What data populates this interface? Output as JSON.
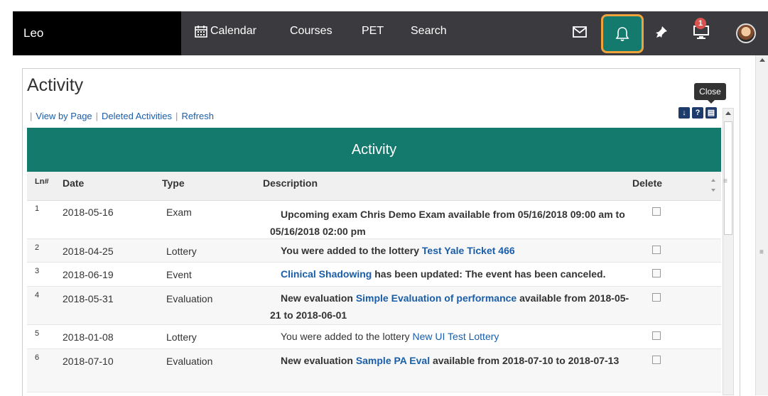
{
  "topbar": {
    "brand": "Leo",
    "nav": [
      "Calendar",
      "Courses",
      "PET",
      "Search"
    ],
    "badge_count": "1"
  },
  "tooltip": {
    "close": "Close"
  },
  "page": {
    "title": "Activity",
    "links": [
      "View by Page",
      "Deleted Activities",
      "Refresh"
    ],
    "tool_icons": [
      "download-icon",
      "help-icon",
      "print-icon"
    ]
  },
  "table": {
    "title": "Activity",
    "columns": [
      "Ln#",
      "Date",
      "Type",
      "Description",
      "Delete"
    ],
    "rows": [
      {
        "ln": "1",
        "date": "2018-05-16",
        "type": "Exam",
        "desc_pre": "Upcoming exam Chris Demo Exam available from 05/16/2018 09:00 am to 05/16/2018 02:00 pm",
        "link": "",
        "desc_post": ""
      },
      {
        "ln": "2",
        "date": "2018-04-25",
        "type": "Lottery",
        "desc_pre": "You were added to the lottery ",
        "link": "Test Yale Ticket 466",
        "desc_post": ""
      },
      {
        "ln": "3",
        "date": "2018-06-19",
        "type": "Event",
        "desc_pre": "",
        "link": "Clinical Shadowing",
        "desc_post": " has been updated: The event has been canceled."
      },
      {
        "ln": "4",
        "date": "2018-05-31",
        "type": "Evaluation",
        "desc_pre": "New evaluation ",
        "link": "Simple Evaluation of performance",
        "desc_post": " available from 2018-05-21 to 2018-06-01"
      },
      {
        "ln": "5",
        "date": "2018-01-08",
        "type": "Lottery",
        "desc_pre": "You were added to the lottery ",
        "link": "New UI Test Lottery",
        "desc_post": ""
      },
      {
        "ln": "6",
        "date": "2018-07-10",
        "type": "Evaluation",
        "desc_pre": "New evaluation ",
        "link": "Sample PA Eval",
        "desc_post": " available from 2018-07-10 to 2018-07-13"
      }
    ]
  },
  "colors": {
    "accent": "#147a6e",
    "highlight": "#f0a33a",
    "link": "#1a5ea8"
  }
}
